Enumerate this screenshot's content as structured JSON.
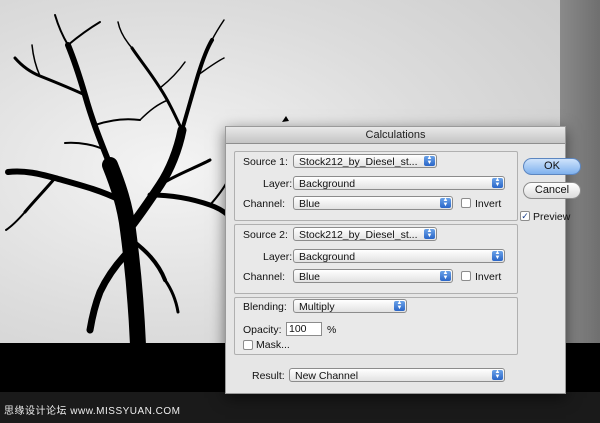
{
  "watermark": "思缘设计论坛 www.MISSYUAN.COM",
  "dialog": {
    "title": "Calculations",
    "source1": {
      "label": "Source 1:",
      "file": "Stock212_by_Diesel_st...",
      "layer_label": "Layer:",
      "layer": "Background",
      "channel_label": "Channel:",
      "channel": "Blue",
      "invert_label": "Invert",
      "invert": false
    },
    "source2": {
      "label": "Source 2:",
      "file": "Stock212_by_Diesel_st...",
      "layer_label": "Layer:",
      "layer": "Background",
      "channel_label": "Channel:",
      "channel": "Blue",
      "invert_label": "Invert",
      "invert": false
    },
    "blending": {
      "label": "Blending:",
      "mode": "Multiply",
      "opacity_label": "Opacity:",
      "opacity": "100",
      "opacity_unit": "%",
      "mask_label": "Mask...",
      "mask": false
    },
    "result": {
      "label": "Result:",
      "value": "New Channel"
    },
    "buttons": {
      "ok": "OK",
      "cancel": "Cancel"
    },
    "preview": {
      "label": "Preview",
      "checked": true,
      "mark": "✓"
    }
  }
}
